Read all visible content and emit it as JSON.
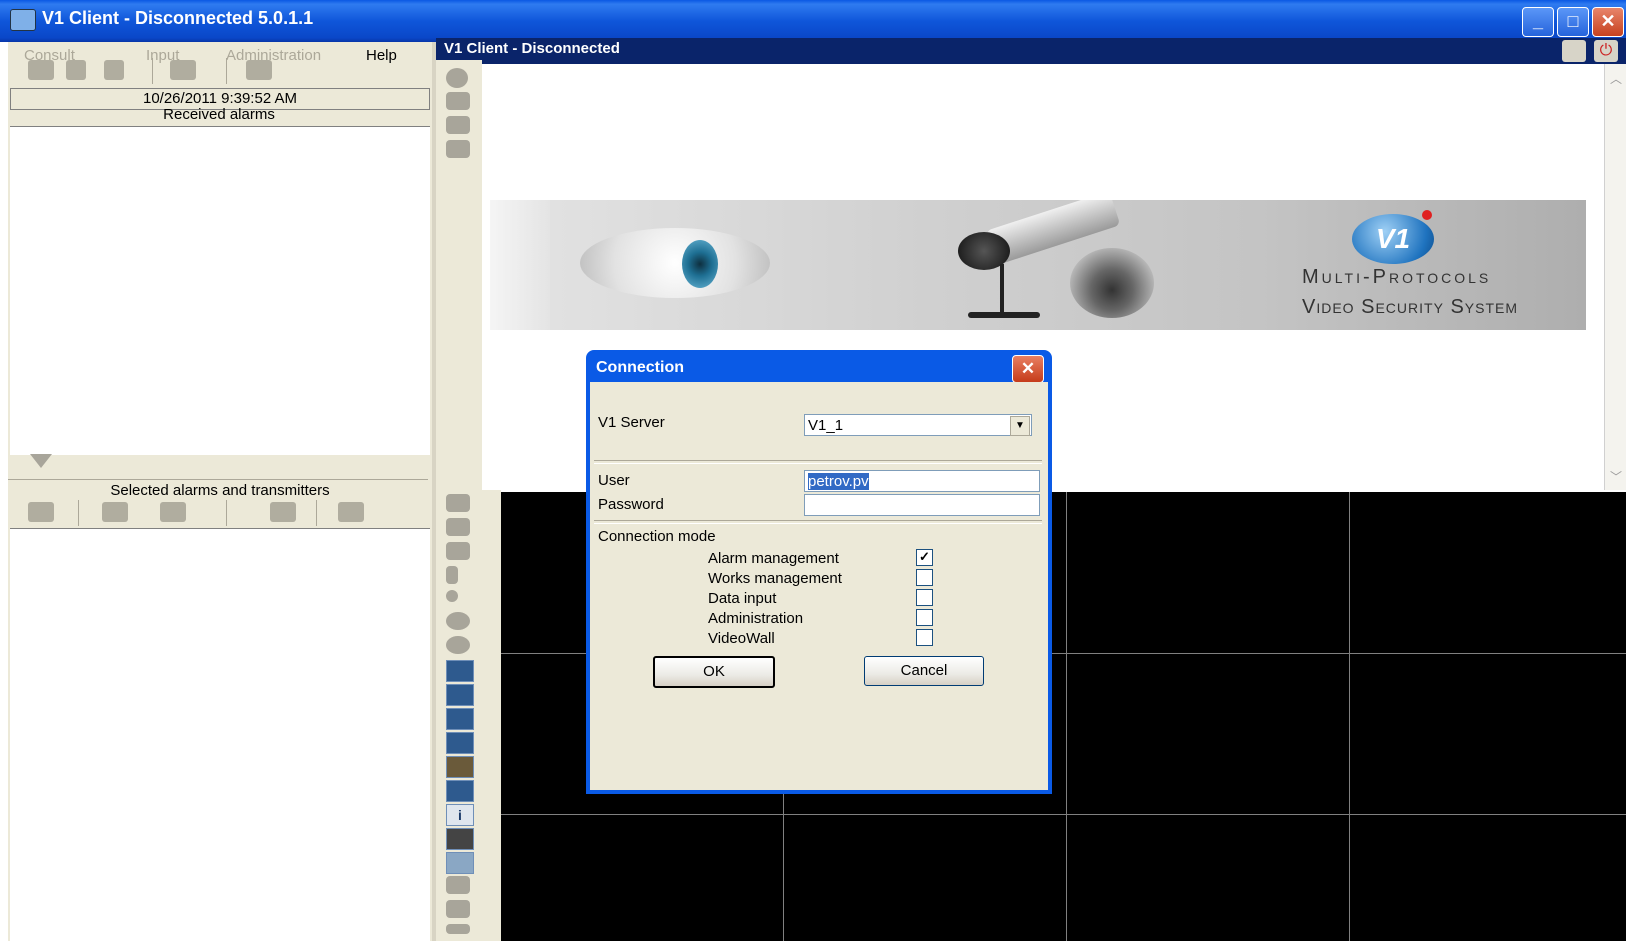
{
  "window": {
    "title": "V1 Client - Disconnected 5.0.1.1",
    "minimize": "_",
    "maximize": "□",
    "close": "✕"
  },
  "menu": {
    "items": [
      {
        "label": "Consult",
        "enabled": false
      },
      {
        "label": "Input",
        "enabled": false
      },
      {
        "label": "Administration",
        "enabled": false
      },
      {
        "label": "Help",
        "enabled": true
      }
    ]
  },
  "left": {
    "datetime": "10/26/2011 9:39:52 AM",
    "received_label": "Received alarms",
    "selected_label": "Selected alarms and transmitters"
  },
  "inner": {
    "title": "V1 Client - Disconnected"
  },
  "banner": {
    "logo_text": "V1",
    "line1": "Multi-Protocols",
    "line2": "Video Security System"
  },
  "dialog": {
    "title": "Connection",
    "close": "✕",
    "server_label": "V1 Server",
    "server_value": "V1_1",
    "user_label": "User",
    "user_value": "petrov.pv",
    "password_label": "Password",
    "password_value": "",
    "mode_label": "Connection mode",
    "modes": [
      {
        "label": "Alarm management",
        "checked": true
      },
      {
        "label": "Works management",
        "checked": false
      },
      {
        "label": "Data input",
        "checked": false
      },
      {
        "label": "Administration",
        "checked": false
      },
      {
        "label": "VideoWall",
        "checked": false
      }
    ],
    "ok_label": "OK",
    "cancel_label": "Cancel"
  }
}
